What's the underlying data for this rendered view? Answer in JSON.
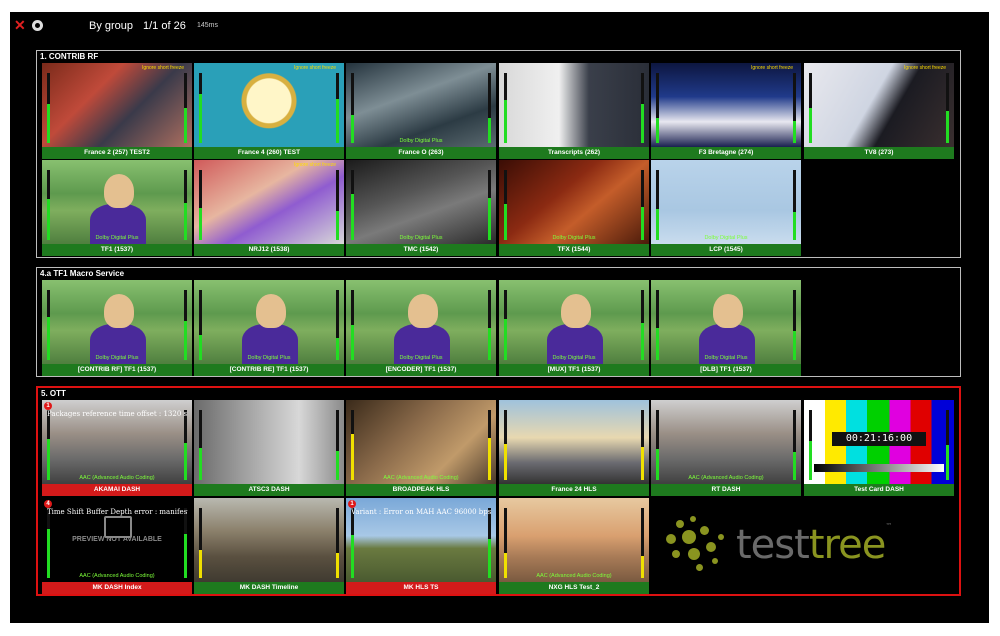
{
  "toolbar": {
    "grouping": "By group",
    "pagination": "1/1 of 26",
    "refresh": "145ms"
  },
  "groups": [
    {
      "title": "1. CONTRIB RF",
      "tiles": [
        {
          "label": "France 2 (257) TEST2",
          "ignore": "Ignore short freeze"
        },
        {
          "label": "France 4 (260) TEST",
          "ignore": "Ignore short freeze"
        },
        {
          "label": "France O (263)",
          "ignore": "",
          "overlay": "Dolby Digital Plus"
        },
        {
          "label": "Transcripts (262)",
          "ignore": ""
        },
        {
          "label": "F3 Bretagne (274)",
          "ignore": "Ignore short freeze"
        },
        {
          "label": "TV8 (273)",
          "ignore": "Ignore short freeze"
        },
        {
          "label": "TF1 (1537)",
          "ignore": "",
          "overlay": "Dolby Digital Plus"
        },
        {
          "label": "NRJ12 (1538)",
          "ignore": "Ignore short freeze"
        },
        {
          "label": "TMC (1542)",
          "ignore": "",
          "overlay": "Dolby Digital Plus"
        },
        {
          "label": "TFX (1544)",
          "ignore": "",
          "overlay": "Dolby Digital Plus"
        },
        {
          "label": "LCP (1545)",
          "ignore": "",
          "overlay": "Dolby Digital Plus"
        }
      ]
    },
    {
      "title": "4.a TF1 Macro Service",
      "tiles": [
        {
          "label": "[CONTRIB RF] TF1 (1537)",
          "overlay": "Dolby Digital Plus"
        },
        {
          "label": "[CONTRIB RE] TF1 (1537)",
          "overlay": "Dolby Digital Plus"
        },
        {
          "label": "[ENCODER] TF1 (1537)",
          "overlay": "Dolby Digital Plus"
        },
        {
          "label": "[MUX] TF1 (1537)",
          "overlay": "Dolby Digital Plus"
        },
        {
          "label": "[DLB] TF1 (1537)",
          "overlay": "Dolby Digital Plus"
        }
      ]
    },
    {
      "title": "5. OTT",
      "tiles": [
        {
          "label": "AKAMAI DASH",
          "error": "1",
          "errtext": "Packages reference time offset : 1320 s",
          "overlay": "AAC (Advanced Audio Coding)"
        },
        {
          "label": "ATSC3 DASH",
          "overlay": ""
        },
        {
          "label": "BROADPEAK HLS",
          "overlay": "AAC (Advanced Audio Coding)"
        },
        {
          "label": "France 24 HLS",
          "overlay": ""
        },
        {
          "label": "RT DASH",
          "overlay": "AAC (Advanced Audio Coding)"
        },
        {
          "label": "Test Card DASH",
          "timecode": "00:21:16:00",
          "overlay": ""
        },
        {
          "label": "MK DASH Index",
          "error": "4",
          "errtext": "Time Shift Buffer Depth error : manifest",
          "na": "PREVIEW NOT AVAILABLE",
          "overlay": "AAC (Advanced Audio Coding)"
        },
        {
          "label": "MK DASH Timeline",
          "overlay": ""
        },
        {
          "label": "MK HLS TS",
          "error": "1",
          "errtext": "Variant : Error on MAH AAC 96000 bps",
          "overlay": ""
        },
        {
          "label": "NXG HLS Test_2",
          "overlay": "AAC (Advanced Audio Coding)"
        }
      ]
    }
  ],
  "logo": {
    "part1": "test",
    "part2": "tree",
    "tm": "™"
  },
  "colors": {
    "ok": "#1e7a1e",
    "error": "#d31a1a",
    "meter": "#22dd22",
    "logo_green": "#8a9420"
  },
  "icons": [
    "close-icon",
    "settings-icon",
    "image-placeholder-icon",
    "error-badge-icon"
  ]
}
